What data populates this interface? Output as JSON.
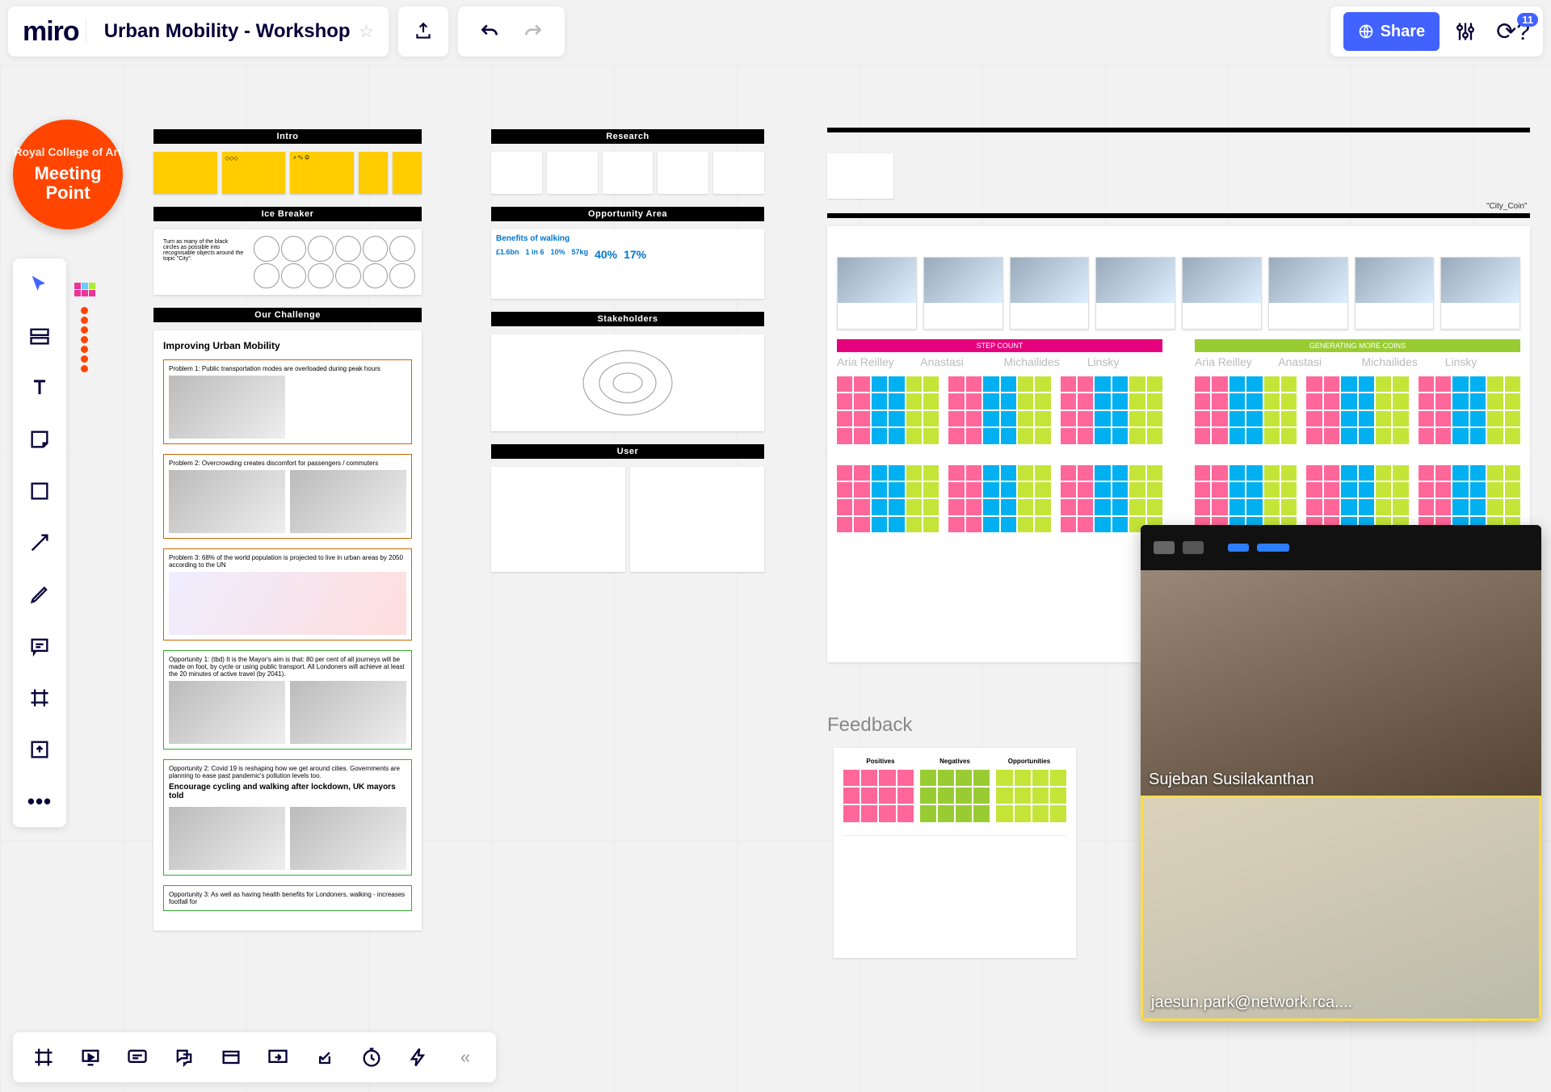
{
  "app": {
    "name": "miro"
  },
  "board": {
    "title": "Urban Mobility - Workshop"
  },
  "topbar": {
    "share_label": "Share",
    "help_badge": "11"
  },
  "meeting_point": {
    "crest": "Royal College of Art",
    "line1": "Meeting",
    "line2": "Point"
  },
  "sections": {
    "intro": "Intro",
    "ice_breaker": "Ice Breaker",
    "our_challenge": "Our Challenge",
    "research": "Research",
    "opportunity_area": "Opportunity Area",
    "stakeholders": "Stakeholders",
    "user": "User",
    "city_coin": "\"City_Coin\""
  },
  "col1": {
    "challenge_title": "Improving Urban Mobility",
    "problems": [
      "Problem 1: Public transportation modes are overloaded during peak hours",
      "Problem 2: Overcrowding creates discomfort for passengers / commuters",
      "Problem 3: 68% of the world population is projected to live in urban areas by 2050 according to the UN"
    ],
    "opportunities": [
      "Opportunity 1: (tbd) It is the Mayor's aim is that: 80 per cent of all journeys will be made on foot, by cycle or using public transport. All Londoners will achieve at least the 20 minutes of active travel (by 2041).",
      "Opportunity 2: Covid 19 is reshaping how we get around cities. Governments are planning to ease past pandemic's pollution levels too.",
      "Opportunity 3: As well as having health benefits for Londoners, walking - increases footfall for"
    ],
    "news_headline": "Encourage cycling and walking after lockdown, UK mayors told"
  },
  "col2": {
    "benefits_title": "Benefits of walking",
    "benefits_stats": [
      "£1.6bn",
      "1 in 6",
      "10%",
      "57kg",
      "40%",
      "17%"
    ]
  },
  "right_frame": {
    "step_count": "STEP COUNT",
    "generating": "GENERATING MORE COINS",
    "names": [
      "Aria Reilley",
      "Anastasi",
      "Michailides",
      "Linsky"
    ]
  },
  "feedback": {
    "label": "Feedback",
    "cols": [
      "Positives",
      "Negatives",
      "Opportunities"
    ]
  },
  "video": {
    "participant1": "Sujeban Susilakanthan",
    "participant2": "jaesun.park@network.rca...."
  }
}
